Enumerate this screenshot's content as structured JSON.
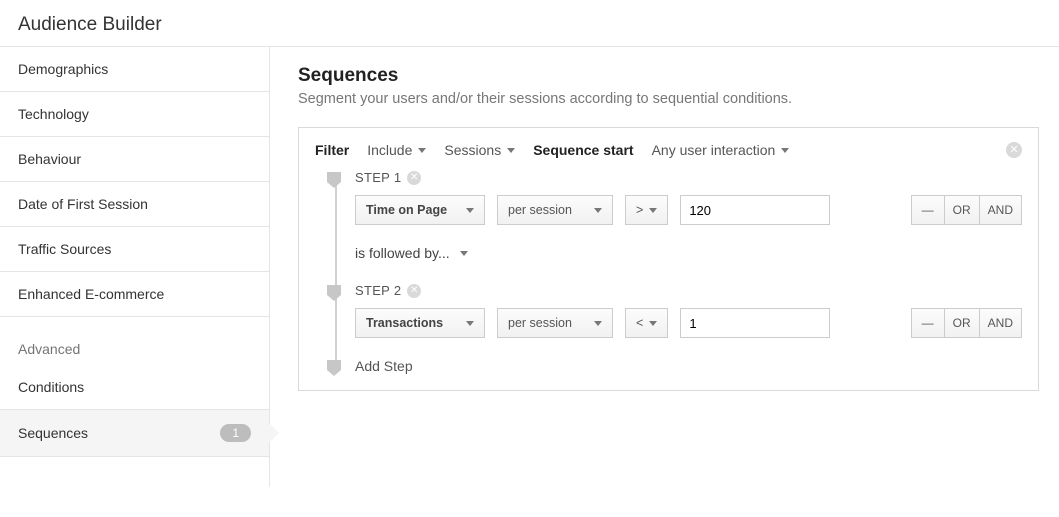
{
  "header": {
    "title": "Audience Builder"
  },
  "sidebar": {
    "items": [
      "Demographics",
      "Technology",
      "Behaviour",
      "Date of First Session",
      "Traffic Sources",
      "Enhanced E-commerce"
    ],
    "group_label": "Advanced",
    "advanced": {
      "conditions": "Conditions",
      "sequences": "Sequences",
      "sequences_count": "1"
    }
  },
  "main": {
    "title": "Sequences",
    "subtitle": "Segment your users and/or their sessions according to sequential conditions."
  },
  "filter_bar": {
    "filter_label": "Filter",
    "include": "Include",
    "sessions": "Sessions",
    "seq_start_label": "Sequence start",
    "seq_start_value": "Any user interaction"
  },
  "steps": [
    {
      "label": "STEP 1",
      "dimension": "Time on Page",
      "scope": "per session",
      "operator": ">",
      "value": "120",
      "ops": {
        "remove": "—",
        "or": "OR",
        "and": "AND"
      },
      "followed_by": "is followed by..."
    },
    {
      "label": "STEP 2",
      "dimension": "Transactions",
      "scope": "per session",
      "operator": "<",
      "value": "1",
      "ops": {
        "remove": "—",
        "or": "OR",
        "and": "AND"
      }
    }
  ],
  "add_step": "Add Step"
}
